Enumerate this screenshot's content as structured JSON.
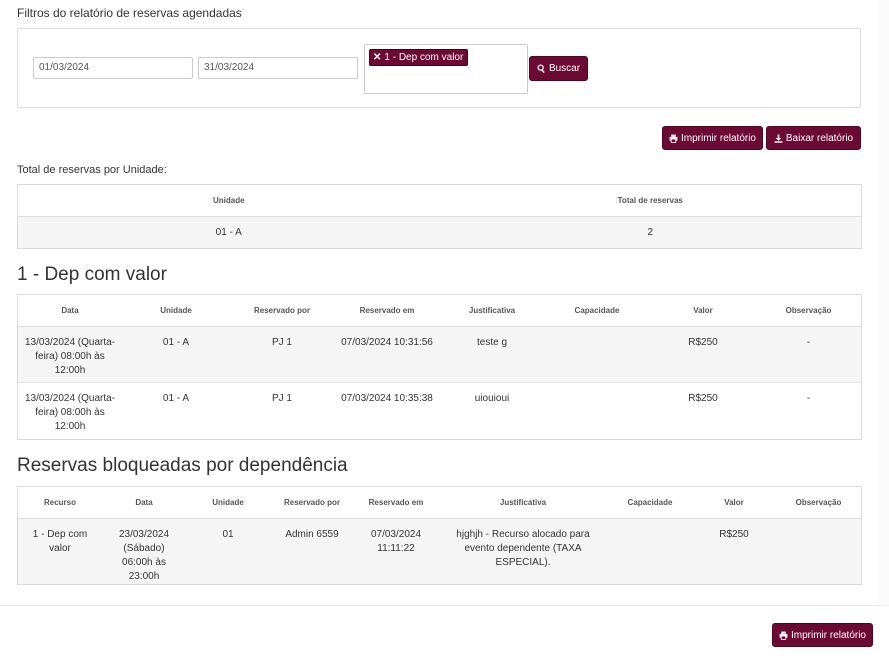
{
  "filters": {
    "section_title": "Filtros do relatório de reservas agendadas",
    "date_start": "01/03/2024",
    "date_end": "31/03/2024",
    "selected_resource": "1 - Dep com valor",
    "search_label": "Buscar"
  },
  "actions": {
    "print_label": "Imprimir relatório",
    "download_label": "Baixar relatório"
  },
  "summary": {
    "title": "Total de reservas por Unidade:",
    "headers": [
      "Unidade",
      "Total de reservas"
    ],
    "rows": [
      [
        "01 - A",
        "2"
      ]
    ]
  },
  "resource_section": {
    "title": "1 - Dep com valor",
    "headers": [
      "Data",
      "Unidade",
      "Reservado por",
      "Reservado em",
      "Justificativa",
      "Capacidade",
      "Valor",
      "Observação"
    ],
    "rows": [
      [
        "13/03/2024 (Quarta-feira) 08:00h às 12:00h",
        "01 - A",
        "PJ 1",
        "07/03/2024 10:31:56",
        "teste g",
        "",
        "R$250",
        "-"
      ],
      [
        "13/03/2024 (Quarta-feira) 08:00h às 12:00h",
        "01 - A",
        "PJ 1",
        "07/03/2024 10:35:38",
        "uiouioui",
        "",
        "R$250",
        "-"
      ]
    ]
  },
  "blocked_section": {
    "title": "Reservas bloqueadas por dependência",
    "headers": [
      "Recurso",
      "Data",
      "Unidade",
      "Reservado por",
      "Reservado em",
      "Justificativa",
      "Capacidade",
      "Valor",
      "Observação"
    ],
    "rows": [
      [
        "1 - Dep com valor",
        "23/03/2024 (Sábado) 06:00h às 23:00h",
        "01",
        "Admin 6559",
        "07/03/2024 11:11:22",
        "hjghjh - Recurso alocado para evento dependente (TAXA ESPECIAL).",
        "",
        "R$250",
        ""
      ]
    ]
  },
  "footer": {
    "print_label": "Imprimir relatório"
  },
  "colors": {
    "accent": "#6d0a34",
    "border": "#dcdcdc",
    "row_shade": "#f5f5f5"
  },
  "icons": {
    "print": "printer-icon",
    "download": "download-icon",
    "search": "search-icon",
    "remove": "close-icon"
  }
}
